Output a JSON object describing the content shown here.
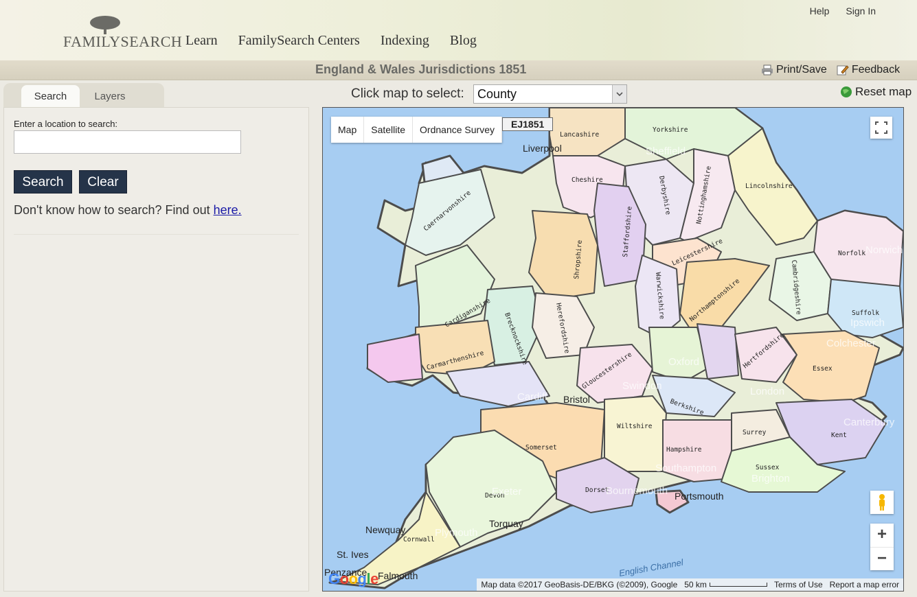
{
  "header": {
    "logo_text": "FAMILYSEARCH",
    "nav": [
      "Learn",
      "FamilySearch Centers",
      "Indexing",
      "Blog"
    ],
    "utility": [
      "Help",
      "Sign In"
    ]
  },
  "titlebar": {
    "title": "England & Wales Jurisdictions 1851",
    "print_save": "Print/Save",
    "feedback": "Feedback"
  },
  "left_panel": {
    "tabs": [
      "Search",
      "Layers"
    ],
    "location_label": "Enter a location to search:",
    "location_value": "",
    "search_button": "Search",
    "clear_button": "Clear",
    "help_prefix": "Don't know how to search? Find out ",
    "help_link": "here."
  },
  "map_toolbar": {
    "select_label": "Click map to select:",
    "select_value": "County",
    "reset_label": "Reset map"
  },
  "map": {
    "map_types": [
      "Map",
      "Satellite",
      "Ordnance Survey"
    ],
    "layer_badge": "EJ1851",
    "counties": [
      "Lancashire",
      "Yorkshire",
      "Cheshire",
      "Derbyshire",
      "Nottinghamshire",
      "Lincolnshire",
      "Caernarvonshire",
      "Shropshire",
      "Staffordshire",
      "Leicestershire",
      "Norfolk",
      "Warwickshire",
      "Northamptonshire",
      "Cambridgeshire",
      "Cardiganshire",
      "Brecknockshire",
      "Herefordshire",
      "Suffolk",
      "Carmarthenshire",
      "Gloucestershire",
      "Hertfordshire",
      "Essex",
      "Berkshire",
      "Somerset",
      "Wiltshire",
      "Surrey",
      "Kent",
      "Hampshire",
      "Sussex",
      "Devon",
      "Dorset",
      "Cornwall"
    ],
    "places": [
      "Liverpool",
      "Sheffield",
      "Bristol",
      "London",
      "Norwich",
      "Ipswich",
      "Brighton",
      "Torquay",
      "Exeter",
      "Plymouth",
      "Newquay",
      "St. Ives",
      "Cardiff",
      "Portsmouth",
      "Southampton",
      "Bournemouth",
      "Swindon",
      "Oxford",
      "Canterbury",
      "Colchester",
      "Penzance",
      "Falmouth"
    ],
    "sea_label": "English Channel",
    "google_logo": "Google",
    "attribution": "Map data ©2017 GeoBasis-DE/BKG (©2009), Google",
    "scale": "50 km",
    "terms": "Terms of Use",
    "report": "Report a map error",
    "zoom_in": "+",
    "zoom_out": "−"
  }
}
